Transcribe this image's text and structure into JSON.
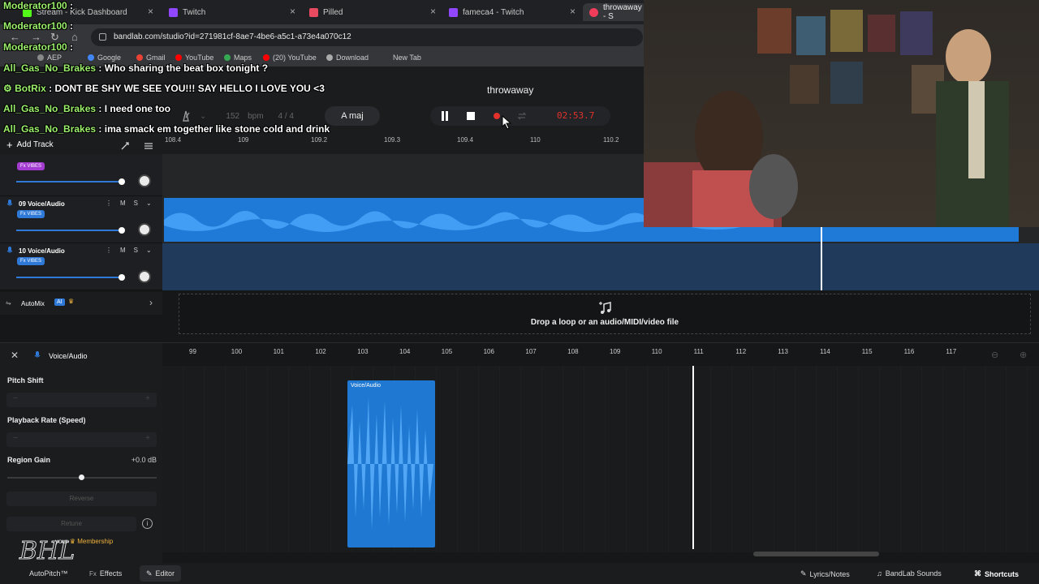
{
  "tabs": [
    {
      "label": "Stream - Kick Dashboard",
      "color": "#53fc18"
    },
    {
      "label": "Twitch",
      "color": "#9146ff"
    },
    {
      "label": "Pilled",
      "color": "#e84a5f"
    },
    {
      "label": "fameca4 - Twitch",
      "color": "#9146ff"
    },
    {
      "label": "throwaway - S",
      "color": "#f23d5a"
    }
  ],
  "address": "bandlab.com/studio?id=271981cf-8ae7-4be6-a5c1-a73e4a070c12",
  "bookmarks": [
    {
      "label": "AEP",
      "color": "#888"
    },
    {
      "label": "Google",
      "color": "#4285f4"
    },
    {
      "label": "Gmail",
      "color": "#ea4335"
    },
    {
      "label": "YouTube",
      "color": "#ff0000"
    },
    {
      "label": "Maps",
      "color": "#34a853"
    },
    {
      "label": "(20) YouTube",
      "color": "#ff0000"
    },
    {
      "label": "Download",
      "color": "#aaa"
    },
    {
      "label": "New Tab",
      "color": "#666"
    }
  ],
  "studio": {
    "project_title": "throwaway",
    "bpm_value": "152",
    "bpm_unit": "bpm",
    "time_signature": "4 / 4",
    "key": "A maj",
    "timecode": "02:53.7",
    "add_track": "Add Track"
  },
  "top_ruler": [
    "108.4",
    "109",
    "109.2",
    "109.3",
    "109.4",
    "110",
    "110.2"
  ],
  "tracks": [
    {
      "name": "09 Voice/Audio",
      "fx": "Fx VIBES",
      "mute": "M",
      "solo": "S"
    },
    {
      "name": "10 Voice/Audio",
      "fx": "Fx VIBES",
      "mute": "M",
      "solo": "S"
    }
  ],
  "prev_track_fx": "Fx VIBES",
  "automix": {
    "label": "AutoMix",
    "badge": "AI"
  },
  "dropzone_text": "Drop a loop or an audio/MIDI/video file",
  "editor": {
    "title": "Voice/Audio",
    "pitch_shift": "Pitch Shift",
    "playback_rate": "Playback Rate (Speed)",
    "region_gain": "Region Gain",
    "region_gain_value": "+0.0 dB",
    "reverse": "Reverse",
    "retune": "Retune",
    "upgrade_text": "your",
    "membership": "Membership",
    "clip_label": "Voice/Audio",
    "ruler": [
      "99",
      "100",
      "101",
      "102",
      "103",
      "104",
      "105",
      "106",
      "107",
      "108",
      "109",
      "110",
      "111",
      "112",
      "113",
      "114",
      "115",
      "116",
      "117"
    ]
  },
  "bottom": {
    "autopitch": "AutoPitch™",
    "effects": "Effects",
    "editor": "Editor",
    "lyrics": "Lyrics/Notes",
    "sounds": "BandLab Sounds",
    "shortcuts": "Shortcuts"
  },
  "chat": [
    {
      "user": "Moderator100",
      "msg": ":"
    },
    {
      "user": "Moderator100",
      "msg": ":"
    },
    {
      "user": "Moderator100",
      "msg": ":"
    },
    {
      "user": "All_Gas_No_Brakes",
      "msg": ": Who sharing the beat box tonight ?"
    },
    {
      "user": "BotRix",
      "msg": ": DONT BE SHY WE SEE YOU!!! SAY HELLO I LOVE YOU <3"
    },
    {
      "user": "All_Gas_No_Brakes",
      "msg": ": I need one too"
    },
    {
      "user": "All_Gas_No_Brakes",
      "msg": ": ima smack em together like stone cold and drink"
    }
  ],
  "watermark": "BHL",
  "colors": {
    "accent": "#1e7ad6",
    "record": "#e4312b",
    "fx_purple": "#a33bd1",
    "fx_blue": "#2f7ad9",
    "chat_user": "#9bf06b"
  }
}
